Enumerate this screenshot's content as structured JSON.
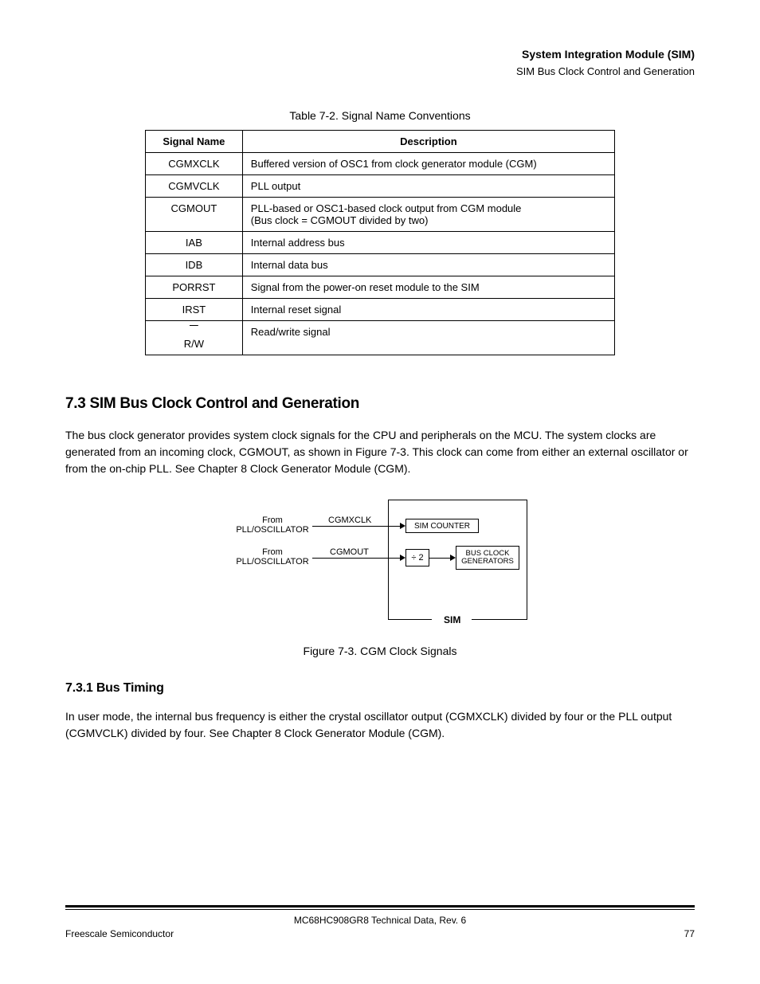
{
  "header": {
    "section": "System Integration Module (SIM)",
    "subtitle": "SIM Bus Clock Control and Generation"
  },
  "table": {
    "title": "Table 7-2. Signal Name Conventions",
    "headers": [
      "Signal Name",
      "Description"
    ],
    "rows": [
      {
        "signal": "CGMXCLK",
        "desc": "Buffered version of OSC1 from clock generator module (CGM)"
      },
      {
        "signal": "CGMVCLK",
        "desc": "PLL output"
      },
      {
        "signal": "CGMOUT",
        "desc": "PLL-based or OSC1-based clock output from CGM module\n(Bus clock = CGMOUT divided by two)"
      },
      {
        "signal": "IAB",
        "desc": "Internal address bus"
      },
      {
        "signal": "IDB",
        "desc": "Internal data bus"
      },
      {
        "signal": "PORRST",
        "desc": "Signal from the power-on reset module to the SIM"
      },
      {
        "signal": "IRST",
        "desc": "Internal reset signal"
      },
      {
        "signal": "R/W",
        "desc": "Read/write signal"
      }
    ]
  },
  "section73": {
    "heading": "7.3  SIM Bus Clock Control and Generation",
    "p1": "The bus clock generator provides system clock signals for the CPU and peripherals on the MCU. The system clocks are generated from an incoming clock, CGMOUT, as shown in Figure 7-3. This clock can come from either an external oscillator or from the on-chip PLL. See Chapter 8 Clock Generator Module (CGM)."
  },
  "figure": {
    "from1": "From",
    "pllosc1": "PLL/OSCILLATOR",
    "from2": "From",
    "pllosc2": "PLL/OSCILLATOR",
    "cgmxclk": "CGMXCLK",
    "cgmout": "CGMOUT",
    "simcounter": "SIM COUNTER",
    "div2": "÷ 2",
    "busclock": "BUS CLOCK",
    "generators": "GENERATORS",
    "sim": "SIM",
    "caption": "Figure 7-3. CGM Clock Signals"
  },
  "section731": {
    "heading": "7.3.1  Bus Timing",
    "p1": "In user mode, the internal bus frequency is either the crystal oscillator output (CGMXCLK) divided by four or the PLL output (CGMVCLK) divided by four. See Chapter 8 Clock Generator Module (CGM)."
  },
  "footer": {
    "title": "MC68HC908GR8 Technical Data, Rev. 6",
    "left": "Freescale Semiconductor",
    "right": "77"
  }
}
